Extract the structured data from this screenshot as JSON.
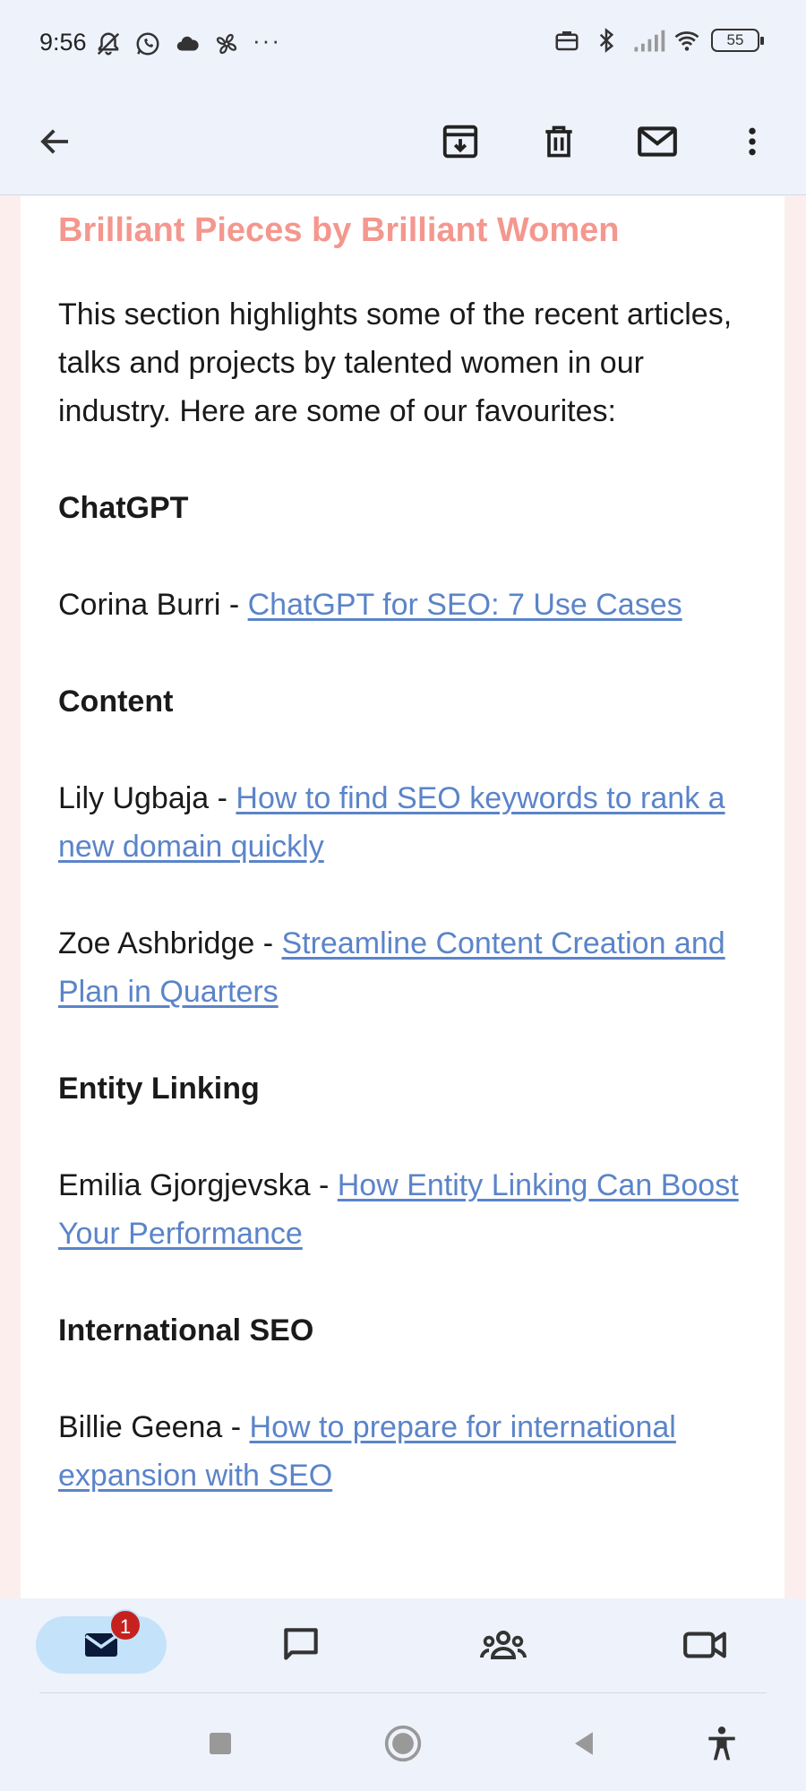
{
  "status_bar": {
    "time": "9:56",
    "left_icons": [
      "mute-bell-icon",
      "whatsapp-icon",
      "cloud-icon",
      "fan-icon"
    ],
    "more": "···",
    "right_icons": [
      "briefcase-icon",
      "bluetooth-icon",
      "signal-icon",
      "wifi-icon"
    ],
    "battery": "55"
  },
  "toolbar": {
    "back_icon": "arrow-left-icon",
    "archive_icon": "archive-icon",
    "delete_icon": "trash-icon",
    "mark_unread_icon": "mail-icon",
    "more_icon": "more-vert-icon"
  },
  "email": {
    "section_title": "Brilliant Pieces by Brilliant Women",
    "intro": "This section highlights some of the recent articles, talks and projects by talented women in our industry. Here are some of our favourites:",
    "categories": [
      {
        "heading": "ChatGPT",
        "entries": [
          {
            "author": "Corina Burri - ",
            "link": "ChatGPT for SEO: 7 Use Cases"
          }
        ]
      },
      {
        "heading": "Content",
        "entries": [
          {
            "author": "Lily Ugbaja - ",
            "link": "How to find SEO keywords to rank a new domain quickly"
          },
          {
            "author": "Zoe Ashbridge - ",
            "link": "Streamline Content Creation and Plan in Quarters"
          }
        ]
      },
      {
        "heading": "Entity Linking",
        "entries": [
          {
            "author": "Emilia Gjorgjevska - ",
            "link": "How Entity Linking Can Boost Your Performance"
          }
        ]
      },
      {
        "heading": "International SEO",
        "entries": [
          {
            "author": "Billie Geena - ",
            "link": "How to prepare for international expansion with SEO"
          }
        ]
      }
    ]
  },
  "bottom_nav": {
    "mail_badge": "1",
    "items": [
      "mail-icon",
      "chat-icon",
      "spaces-icon",
      "meet-icon"
    ]
  },
  "colors": {
    "title": "#f4978e",
    "link": "#5b84c9",
    "badge": "#c5221f",
    "active_pill": "#c5e2fb",
    "background": "#eef2fb"
  }
}
